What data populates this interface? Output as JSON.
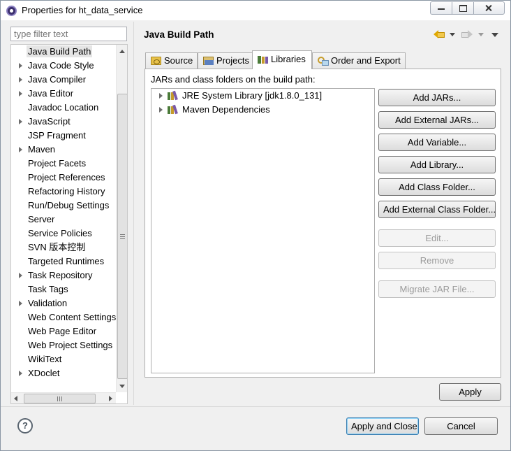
{
  "window": {
    "title": "Properties for ht_data_service"
  },
  "filter": {
    "placeholder": "type filter text"
  },
  "tree": {
    "items": [
      {
        "label": "Java Build Path",
        "expandable": false,
        "selected": true
      },
      {
        "label": "Java Code Style",
        "expandable": true
      },
      {
        "label": "Java Compiler",
        "expandable": true
      },
      {
        "label": "Java Editor",
        "expandable": true
      },
      {
        "label": "Javadoc Location",
        "expandable": false
      },
      {
        "label": "JavaScript",
        "expandable": true
      },
      {
        "label": "JSP Fragment",
        "expandable": false
      },
      {
        "label": "Maven",
        "expandable": true
      },
      {
        "label": "Project Facets",
        "expandable": false
      },
      {
        "label": "Project References",
        "expandable": false
      },
      {
        "label": "Refactoring History",
        "expandable": false
      },
      {
        "label": "Run/Debug Settings",
        "expandable": false
      },
      {
        "label": "Server",
        "expandable": false
      },
      {
        "label": "Service Policies",
        "expandable": false
      },
      {
        "label": "SVN 版本控制",
        "expandable": false
      },
      {
        "label": "Targeted Runtimes",
        "expandable": false
      },
      {
        "label": "Task Repository",
        "expandable": true
      },
      {
        "label": "Task Tags",
        "expandable": false
      },
      {
        "label": "Validation",
        "expandable": true
      },
      {
        "label": "Web Content Settings",
        "expandable": false
      },
      {
        "label": "Web Page Editor",
        "expandable": false
      },
      {
        "label": "Web Project Settings",
        "expandable": false
      },
      {
        "label": "WikiText",
        "expandable": false
      },
      {
        "label": "XDoclet",
        "expandable": true
      }
    ]
  },
  "page": {
    "title": "Java Build Path"
  },
  "tabs": [
    {
      "label": "Source",
      "icon": "source-folder-icon",
      "active": false
    },
    {
      "label": "Projects",
      "icon": "projects-icon",
      "active": false
    },
    {
      "label": "Libraries",
      "icon": "libraries-icon",
      "active": true
    },
    {
      "label": "Order and Export",
      "icon": "order-export-icon",
      "active": false
    }
  ],
  "libraries": {
    "label": "JARs and class folders on the build path:",
    "entries": [
      {
        "label": "JRE System Library [jdk1.8.0_131]"
      },
      {
        "label": "Maven Dependencies"
      }
    ]
  },
  "buttons": {
    "add_jars": "Add JARs...",
    "add_external_jars": "Add External JARs...",
    "add_variable": "Add Variable...",
    "add_library": "Add Library...",
    "add_class_folder": "Add Class Folder...",
    "add_external_class_folder": "Add External Class Folder...",
    "edit": "Edit...",
    "remove": "Remove",
    "migrate_jar": "Migrate JAR File...",
    "apply": "Apply",
    "apply_and_close": "Apply and Close",
    "cancel": "Cancel"
  },
  "help": {
    "glyph": "?"
  }
}
